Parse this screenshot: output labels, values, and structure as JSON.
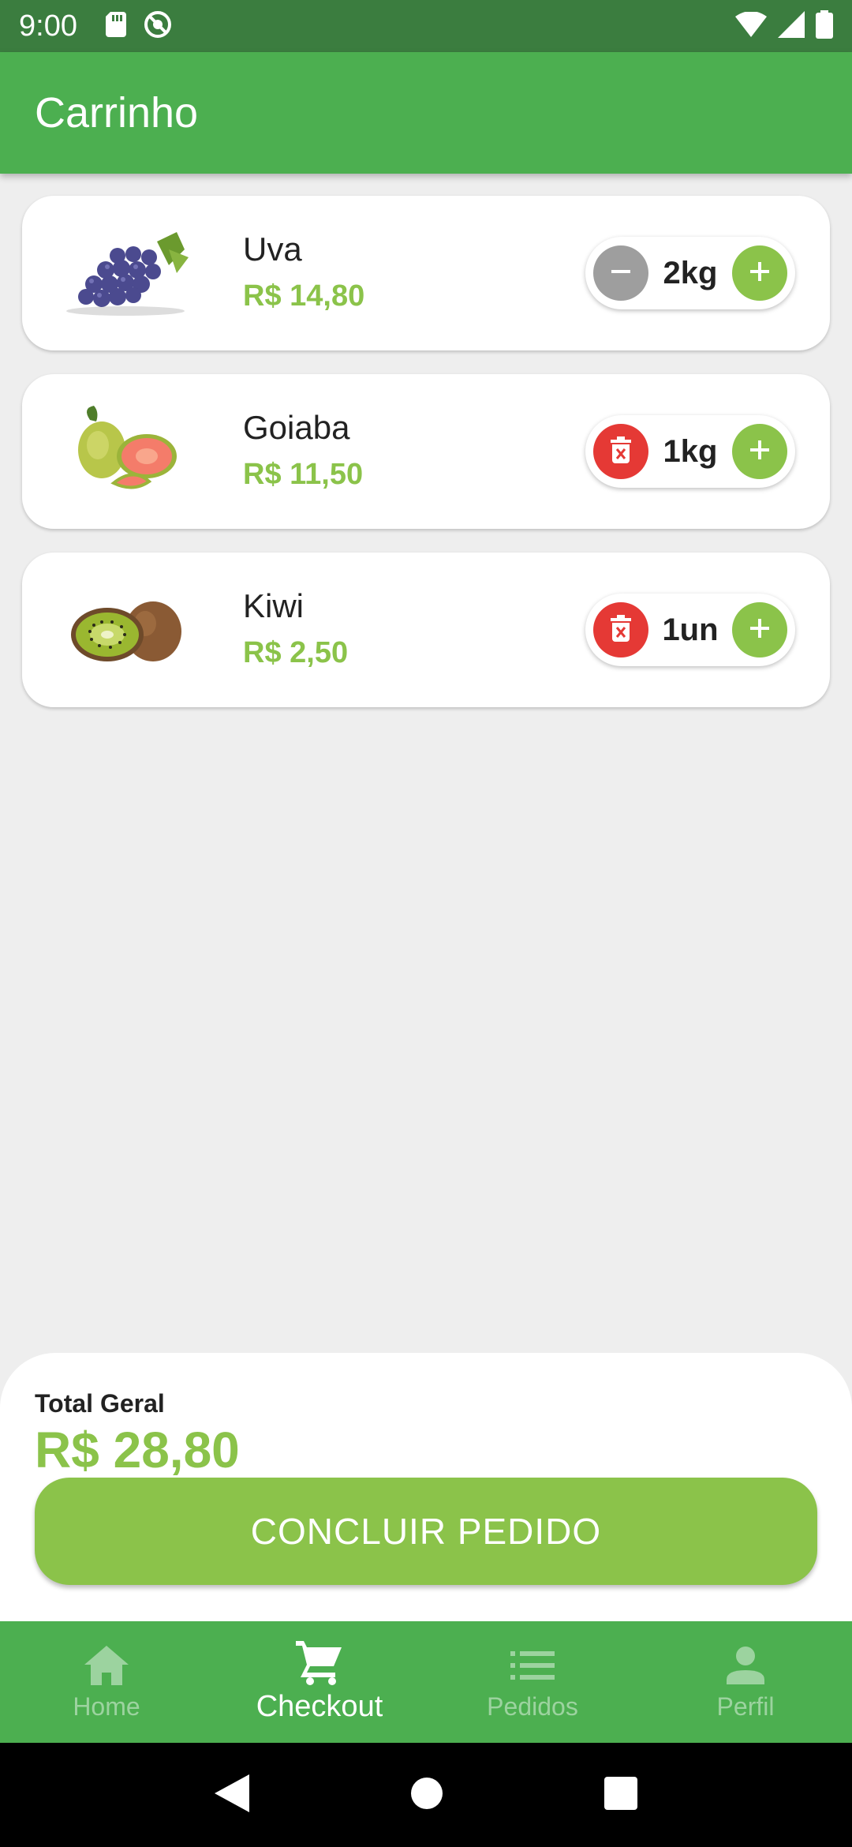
{
  "status_bar": {
    "time": "9:00"
  },
  "app_bar": {
    "title": "Carrinho"
  },
  "cart": {
    "items": [
      {
        "name": "Uva",
        "price": "R$ 14,80",
        "quantity": "2kg",
        "decrement_icon": "minus-icon",
        "image": "grape-bunch"
      },
      {
        "name": "Goiaba",
        "price": "R$ 11,50",
        "quantity": "1kg",
        "decrement_icon": "trash-icon",
        "image": "guava"
      },
      {
        "name": "Kiwi",
        "price": "R$ 2,50",
        "quantity": "1un",
        "decrement_icon": "trash-icon",
        "image": "kiwi"
      }
    ]
  },
  "summary": {
    "total_label": "Total Geral",
    "total_value": "R$ 28,80",
    "checkout_label": "CONCLUIR PEDIDO"
  },
  "bottom_nav": {
    "items": [
      {
        "label": "Home",
        "icon": "home-icon",
        "active": false
      },
      {
        "label": "Checkout",
        "icon": "cart-icon",
        "active": true
      },
      {
        "label": "Pedidos",
        "icon": "list-icon",
        "active": false
      },
      {
        "label": "Perfil",
        "icon": "person-icon",
        "active": false
      }
    ]
  },
  "colors": {
    "primary": "#4caf50",
    "status_bar": "#3b7d3f",
    "accent": "#8bc34a",
    "danger": "#e53935",
    "neutral_button": "#9e9e9e",
    "background": "#eeeeee"
  }
}
